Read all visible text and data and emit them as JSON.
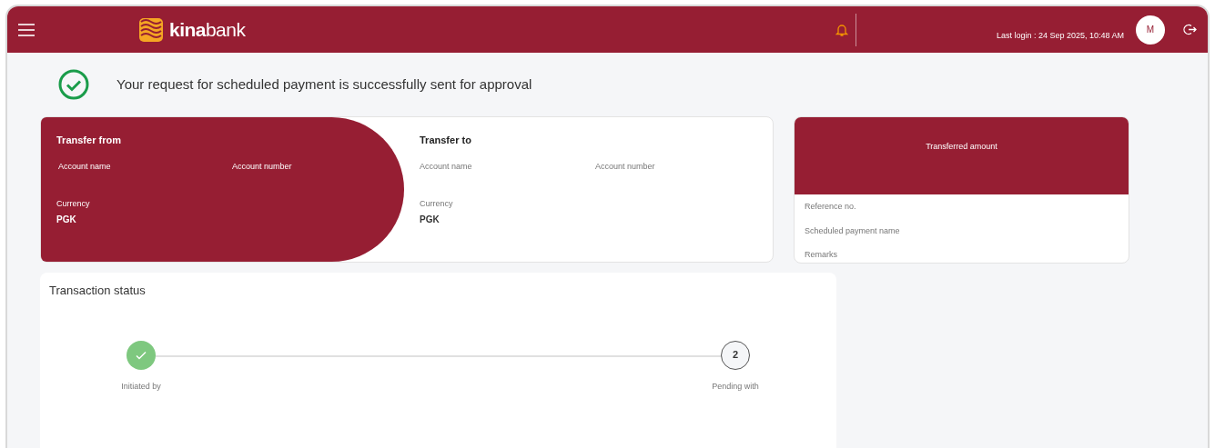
{
  "header": {
    "logo": "**kina**bank",
    "notifications": {
      "unread": true
    },
    "last_login": "Last login : 24 Sep 2025, 10:48 AM",
    "avatar": "M"
  },
  "success_message": "Your request for scheduled payment is successfully sent for approval",
  "transfer_from": {
    "title": "Transfer from",
    "fields": [
      {
        "label": "Account name"
      },
      {
        "label": "Account number"
      },
      {
        "label": "Currency",
        "value": "PGK"
      }
    ]
  },
  "transfer_to": {
    "title": "Transfer to",
    "fields": [
      {
        "label": "Account name"
      },
      {
        "label": "Account number"
      },
      {
        "label": "Currency",
        "value": "PGK"
      }
    ]
  },
  "summary": {
    "title": "Transferred amount",
    "items": [
      "Reference no.",
      "Scheduled payment name",
      "Remarks"
    ]
  },
  "transaction_status": {
    "title": "Transaction status",
    "steps": [
      {
        "label": "Initiated by",
        "completed": true
      },
      {
        "label": "Pending with",
        "number": "2",
        "completed": false
      }
    ]
  }
}
